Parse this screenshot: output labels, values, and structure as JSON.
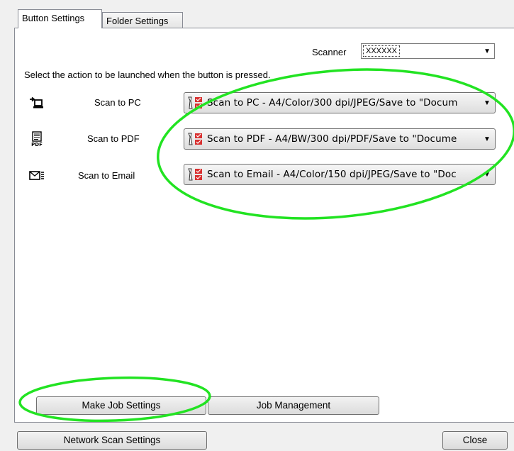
{
  "tabs": [
    {
      "label": "Button Settings",
      "active": true
    },
    {
      "label": "Folder Settings",
      "active": false
    }
  ],
  "scanner": {
    "label": "Scanner",
    "value": "XXXXXX"
  },
  "instruction": "Select the action to be launched when the button is pressed.",
  "actions": [
    {
      "label": "Scan to PC",
      "icon": "scan-to-pc-icon",
      "setting": "Scan to PC - A4/Color/300 dpi/JPEG/Save to \"Docum"
    },
    {
      "label": "Scan to PDF",
      "icon": "pdf-document-icon",
      "setting": "Scan to PDF - A4/BW/300 dpi/PDF/Save to \"Docume"
    },
    {
      "label": "Scan to Email",
      "icon": "envelope-icon",
      "setting": "Scan to Email - A4/Color/150 dpi/JPEG/Save to \"Doc"
    }
  ],
  "buttons": {
    "make_job": "Make Job Settings",
    "job_management": "Job Management",
    "network_scan": "Network Scan Settings",
    "close": "Close"
  },
  "annotation_color": "#22e322"
}
